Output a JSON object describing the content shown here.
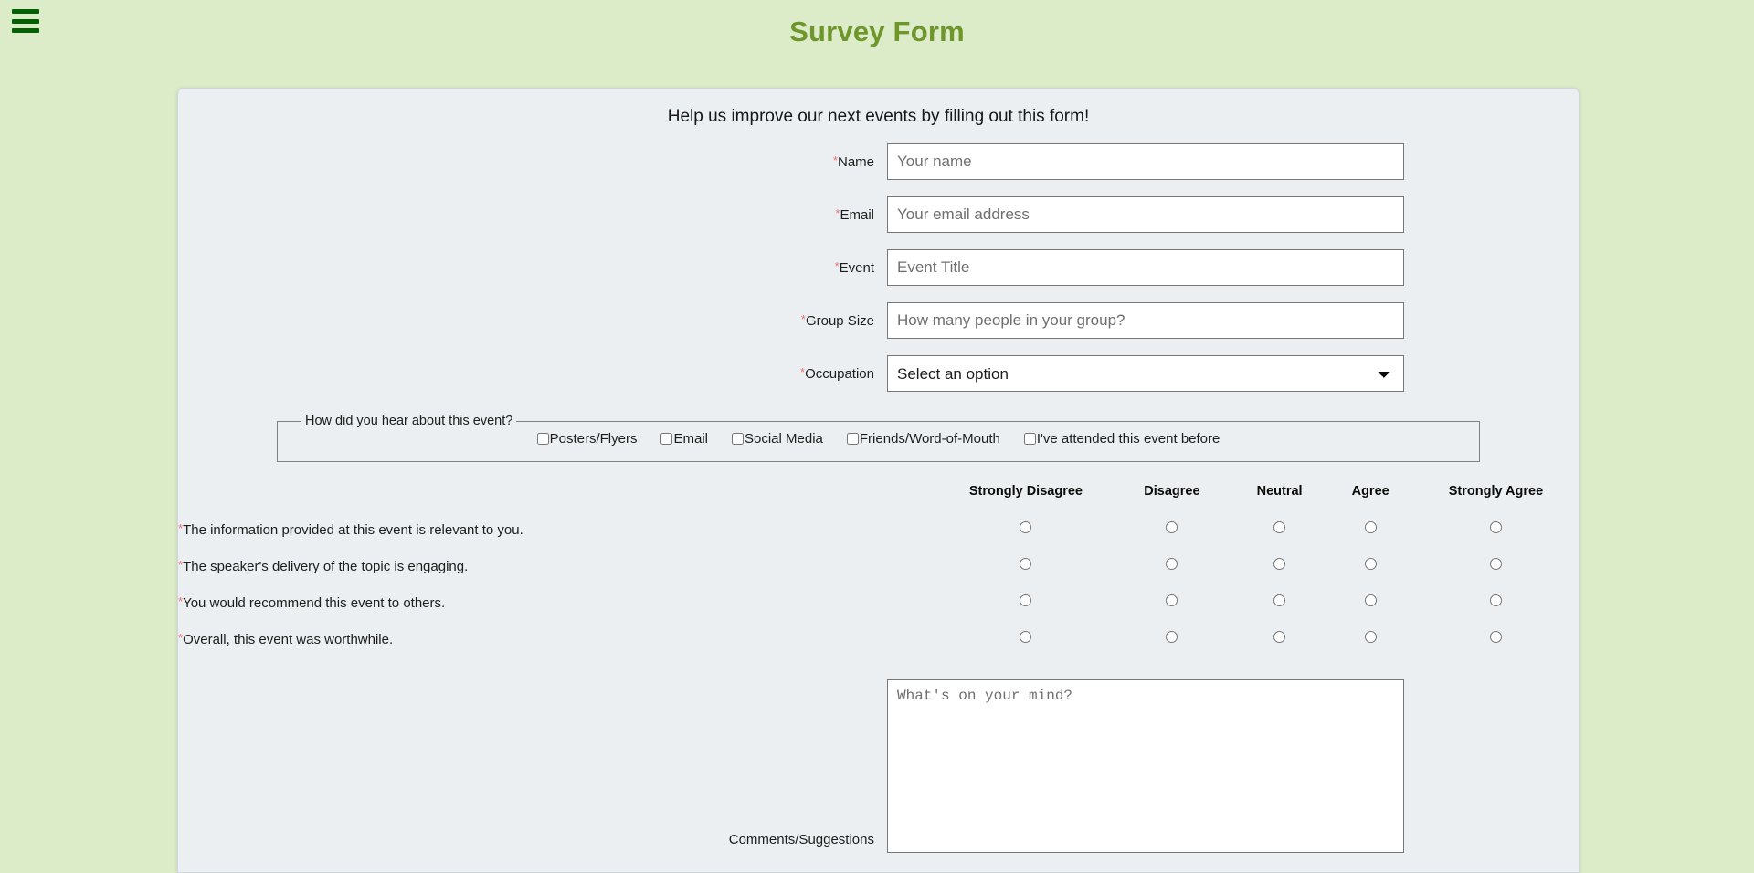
{
  "app": {
    "background_color": "#dcebc8",
    "title": "Survey Form",
    "title_color": "#6f962b"
  },
  "nav": {
    "menu_icon": "hamburger-menu-icon",
    "menu_color": "#036103"
  },
  "card": {
    "background_color": "#ebeff1",
    "subtitle": "Help us improve our next events by filling out this form!"
  },
  "form": {
    "required_marker": "*",
    "required_color": "#f2706f",
    "fields": [
      {
        "label": "Name",
        "placeholder": "Your name",
        "type": "text",
        "value": ""
      },
      {
        "label": "Email",
        "placeholder": "Your email address",
        "type": "email",
        "value": ""
      },
      {
        "label": "Event",
        "placeholder": "Event Title",
        "type": "text",
        "value": ""
      },
      {
        "label": "Group Size",
        "placeholder": "How many people in your group?",
        "type": "number",
        "value": ""
      }
    ],
    "occupation": {
      "label": "Occupation",
      "selected": "Select an option",
      "options": [
        "Select an option"
      ]
    },
    "hear_about": {
      "legend": "How did you hear about this event?",
      "options": [
        {
          "label": "Posters/Flyers",
          "checked": false
        },
        {
          "label": "Email",
          "checked": false
        },
        {
          "label": "Social Media",
          "checked": false
        },
        {
          "label": "Friends/Word-of-Mouth",
          "checked": false
        },
        {
          "label": "I've attended this event before",
          "checked": false
        }
      ]
    },
    "likert": {
      "scale": [
        "Strongly Disagree",
        "Disagree",
        "Neutral",
        "Agree",
        "Strongly Agree"
      ],
      "questions": [
        {
          "text": "The information provided at this event is relevant to you.",
          "selected": null
        },
        {
          "text": "The speaker's delivery of the topic is engaging.",
          "selected": null
        },
        {
          "text": "You would recommend this event to others.",
          "selected": null
        },
        {
          "text": "Overall, this event was worthwhile.",
          "selected": null
        }
      ]
    },
    "comments": {
      "label": "Comments/Suggestions",
      "placeholder": "What's on your mind?",
      "value": ""
    }
  }
}
